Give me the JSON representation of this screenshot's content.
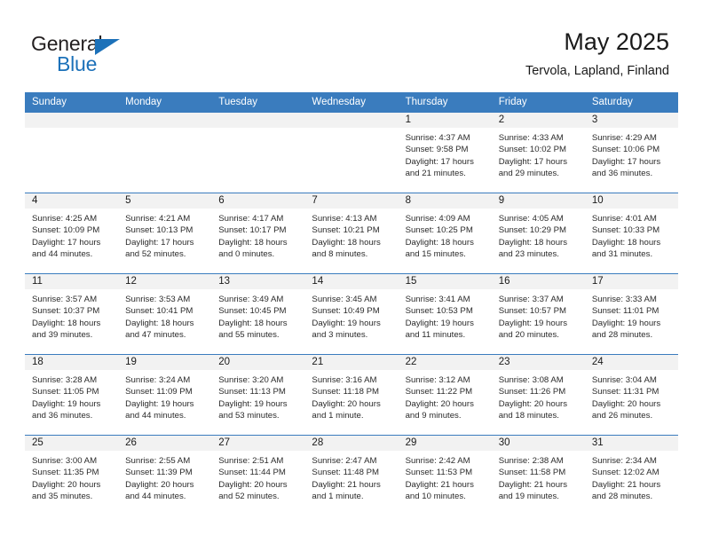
{
  "brand": {
    "name_top": "General",
    "name_bottom": "Blue",
    "accent_color": "#1c71b9"
  },
  "header": {
    "title": "May 2025",
    "subtitle": "Tervola, Lapland, Finland"
  },
  "theme": {
    "header_blue": "#3a7cbe",
    "daynum_band": "#f2f2f2",
    "text": "#1a1a1a"
  },
  "weekday_headers": [
    "Sunday",
    "Monday",
    "Tuesday",
    "Wednesday",
    "Thursday",
    "Friday",
    "Saturday"
  ],
  "weeks": [
    [
      {
        "day": "",
        "lines": []
      },
      {
        "day": "",
        "lines": []
      },
      {
        "day": "",
        "lines": []
      },
      {
        "day": "",
        "lines": []
      },
      {
        "day": "1",
        "lines": [
          "Sunrise: 4:37 AM",
          "Sunset: 9:58 PM",
          "Daylight: 17 hours",
          "and 21 minutes."
        ]
      },
      {
        "day": "2",
        "lines": [
          "Sunrise: 4:33 AM",
          "Sunset: 10:02 PM",
          "Daylight: 17 hours",
          "and 29 minutes."
        ]
      },
      {
        "day": "3",
        "lines": [
          "Sunrise: 4:29 AM",
          "Sunset: 10:06 PM",
          "Daylight: 17 hours",
          "and 36 minutes."
        ]
      }
    ],
    [
      {
        "day": "4",
        "lines": [
          "Sunrise: 4:25 AM",
          "Sunset: 10:09 PM",
          "Daylight: 17 hours",
          "and 44 minutes."
        ]
      },
      {
        "day": "5",
        "lines": [
          "Sunrise: 4:21 AM",
          "Sunset: 10:13 PM",
          "Daylight: 17 hours",
          "and 52 minutes."
        ]
      },
      {
        "day": "6",
        "lines": [
          "Sunrise: 4:17 AM",
          "Sunset: 10:17 PM",
          "Daylight: 18 hours",
          "and 0 minutes."
        ]
      },
      {
        "day": "7",
        "lines": [
          "Sunrise: 4:13 AM",
          "Sunset: 10:21 PM",
          "Daylight: 18 hours",
          "and 8 minutes."
        ]
      },
      {
        "day": "8",
        "lines": [
          "Sunrise: 4:09 AM",
          "Sunset: 10:25 PM",
          "Daylight: 18 hours",
          "and 15 minutes."
        ]
      },
      {
        "day": "9",
        "lines": [
          "Sunrise: 4:05 AM",
          "Sunset: 10:29 PM",
          "Daylight: 18 hours",
          "and 23 minutes."
        ]
      },
      {
        "day": "10",
        "lines": [
          "Sunrise: 4:01 AM",
          "Sunset: 10:33 PM",
          "Daylight: 18 hours",
          "and 31 minutes."
        ]
      }
    ],
    [
      {
        "day": "11",
        "lines": [
          "Sunrise: 3:57 AM",
          "Sunset: 10:37 PM",
          "Daylight: 18 hours",
          "and 39 minutes."
        ]
      },
      {
        "day": "12",
        "lines": [
          "Sunrise: 3:53 AM",
          "Sunset: 10:41 PM",
          "Daylight: 18 hours",
          "and 47 minutes."
        ]
      },
      {
        "day": "13",
        "lines": [
          "Sunrise: 3:49 AM",
          "Sunset: 10:45 PM",
          "Daylight: 18 hours",
          "and 55 minutes."
        ]
      },
      {
        "day": "14",
        "lines": [
          "Sunrise: 3:45 AM",
          "Sunset: 10:49 PM",
          "Daylight: 19 hours",
          "and 3 minutes."
        ]
      },
      {
        "day": "15",
        "lines": [
          "Sunrise: 3:41 AM",
          "Sunset: 10:53 PM",
          "Daylight: 19 hours",
          "and 11 minutes."
        ]
      },
      {
        "day": "16",
        "lines": [
          "Sunrise: 3:37 AM",
          "Sunset: 10:57 PM",
          "Daylight: 19 hours",
          "and 20 minutes."
        ]
      },
      {
        "day": "17",
        "lines": [
          "Sunrise: 3:33 AM",
          "Sunset: 11:01 PM",
          "Daylight: 19 hours",
          "and 28 minutes."
        ]
      }
    ],
    [
      {
        "day": "18",
        "lines": [
          "Sunrise: 3:28 AM",
          "Sunset: 11:05 PM",
          "Daylight: 19 hours",
          "and 36 minutes."
        ]
      },
      {
        "day": "19",
        "lines": [
          "Sunrise: 3:24 AM",
          "Sunset: 11:09 PM",
          "Daylight: 19 hours",
          "and 44 minutes."
        ]
      },
      {
        "day": "20",
        "lines": [
          "Sunrise: 3:20 AM",
          "Sunset: 11:13 PM",
          "Daylight: 19 hours",
          "and 53 minutes."
        ]
      },
      {
        "day": "21",
        "lines": [
          "Sunrise: 3:16 AM",
          "Sunset: 11:18 PM",
          "Daylight: 20 hours",
          "and 1 minute."
        ]
      },
      {
        "day": "22",
        "lines": [
          "Sunrise: 3:12 AM",
          "Sunset: 11:22 PM",
          "Daylight: 20 hours",
          "and 9 minutes."
        ]
      },
      {
        "day": "23",
        "lines": [
          "Sunrise: 3:08 AM",
          "Sunset: 11:26 PM",
          "Daylight: 20 hours",
          "and 18 minutes."
        ]
      },
      {
        "day": "24",
        "lines": [
          "Sunrise: 3:04 AM",
          "Sunset: 11:31 PM",
          "Daylight: 20 hours",
          "and 26 minutes."
        ]
      }
    ],
    [
      {
        "day": "25",
        "lines": [
          "Sunrise: 3:00 AM",
          "Sunset: 11:35 PM",
          "Daylight: 20 hours",
          "and 35 minutes."
        ]
      },
      {
        "day": "26",
        "lines": [
          "Sunrise: 2:55 AM",
          "Sunset: 11:39 PM",
          "Daylight: 20 hours",
          "and 44 minutes."
        ]
      },
      {
        "day": "27",
        "lines": [
          "Sunrise: 2:51 AM",
          "Sunset: 11:44 PM",
          "Daylight: 20 hours",
          "and 52 minutes."
        ]
      },
      {
        "day": "28",
        "lines": [
          "Sunrise: 2:47 AM",
          "Sunset: 11:48 PM",
          "Daylight: 21 hours",
          "and 1 minute."
        ]
      },
      {
        "day": "29",
        "lines": [
          "Sunrise: 2:42 AM",
          "Sunset: 11:53 PM",
          "Daylight: 21 hours",
          "and 10 minutes."
        ]
      },
      {
        "day": "30",
        "lines": [
          "Sunrise: 2:38 AM",
          "Sunset: 11:58 PM",
          "Daylight: 21 hours",
          "and 19 minutes."
        ]
      },
      {
        "day": "31",
        "lines": [
          "Sunrise: 2:34 AM",
          "Sunset: 12:02 AM",
          "Daylight: 21 hours",
          "and 28 minutes."
        ]
      }
    ]
  ]
}
